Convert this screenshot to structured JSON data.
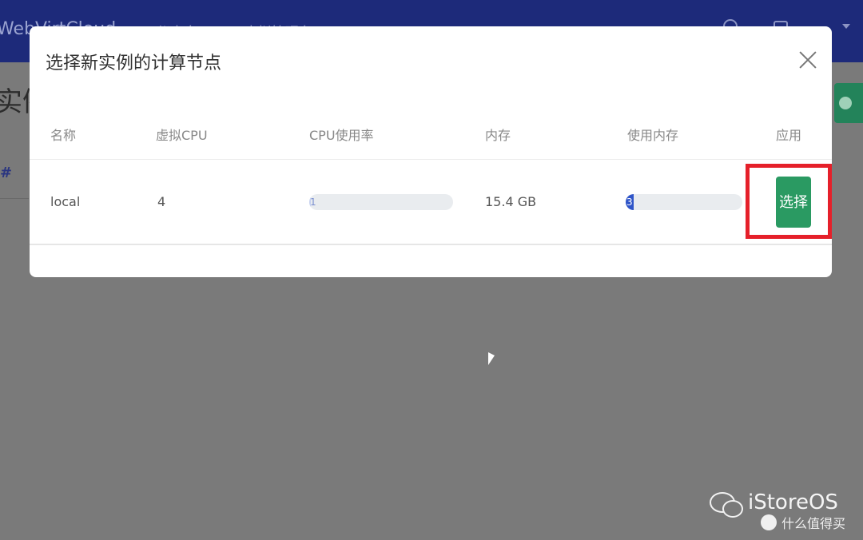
{
  "app": {
    "brand": "WebVirtCloud",
    "nav": [
      "仪表盘",
      "虚拟管理台"
    ]
  },
  "page": {
    "title_partial": "实例",
    "hash": "#"
  },
  "modal": {
    "title": "选择新实例的计算节点",
    "columns": [
      "名称",
      "虚拟CPU",
      "CPU使用率",
      "内存",
      "使用内存",
      "应用"
    ],
    "rows": [
      {
        "name": "local",
        "vcpu": "4",
        "cpu_usage_label": "1",
        "cpu_usage_percent": 1,
        "memory": "15.4 GB",
        "mem_usage_label": "3",
        "mem_usage_percent": 3,
        "action_label": "选择"
      }
    ]
  },
  "colors": {
    "topbar": "#1d2a7a",
    "select_button": "#2a9a62",
    "highlight_box": "#e5202a",
    "mem_fill": "#2f55c8"
  },
  "watermark": {
    "name": "iStoreOS",
    "sub": "什么值得买"
  }
}
